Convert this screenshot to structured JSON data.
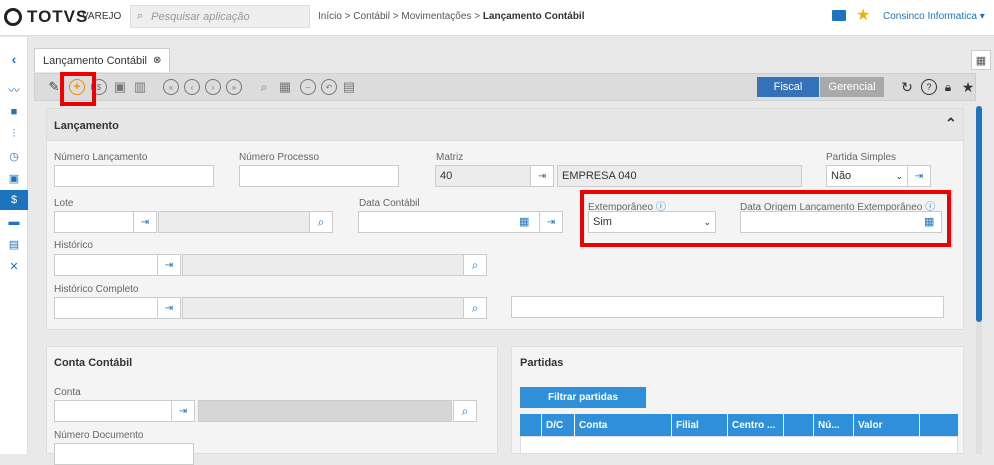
{
  "brand": {
    "name": "TOTVS",
    "sub": "VAREJO"
  },
  "search": {
    "placeholder": "Pesquisar aplicação"
  },
  "breadcrumb": {
    "path": "Início > Contábil > Movimentações > ",
    "current": "Lançamento Contábil"
  },
  "user": {
    "company": "Consinco Informatica"
  },
  "tab": {
    "label": "Lançamento Contábil"
  },
  "toggle": {
    "fiscal": "Fiscal",
    "gerencial": "Gerencial"
  },
  "lancamento": {
    "title": "Lançamento",
    "numero_lancamento": {
      "label": "Número Lançamento",
      "value": ""
    },
    "numero_processo": {
      "label": "Número Processo",
      "value": ""
    },
    "matriz": {
      "label": "Matriz",
      "code": "40",
      "name": "EMPRESA 040"
    },
    "partida_simples": {
      "label": "Partida Simples",
      "value": "Não"
    },
    "lote": {
      "label": "Lote"
    },
    "data_contabil": {
      "label": "Data Contábil"
    },
    "extemporaneo": {
      "label": "Extemporâneo",
      "value": "Sim"
    },
    "data_origem": {
      "label": "Data Origem Lançamento Extemporâneo"
    },
    "historico": {
      "label": "Histórico"
    },
    "historico_completo": {
      "label": "Histórico Completo"
    }
  },
  "conta_contabil": {
    "title": "Conta Contábil",
    "conta": {
      "label": "Conta"
    },
    "numero_documento": {
      "label": "Número Documento"
    }
  },
  "partidas": {
    "title": "Partidas",
    "filter_button": "Filtrar partidas",
    "columns": [
      "D/C",
      "Conta",
      "Filial",
      "Centro ...",
      "Nú...",
      "Valor"
    ]
  },
  "colors": {
    "accent": "#1e73be",
    "highlight": "#e00000",
    "table_header": "#2f8fd8"
  }
}
